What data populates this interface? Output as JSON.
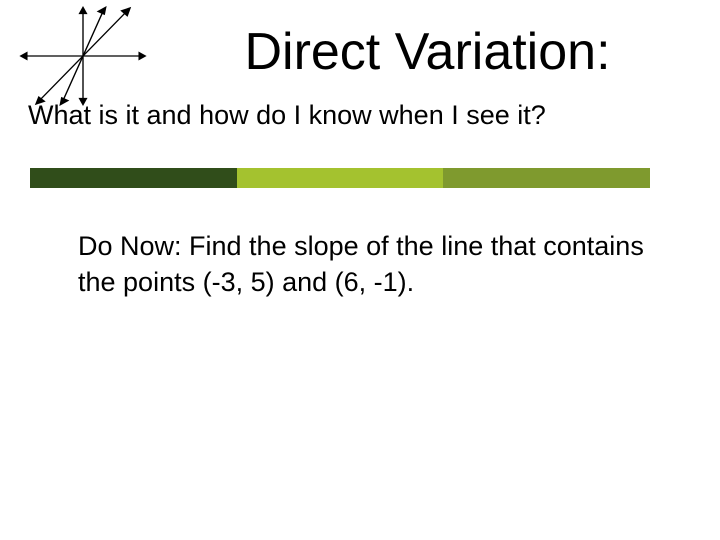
{
  "title": "Direct Variation:",
  "subtitle": "What is it and how do I know when I see it?",
  "body": "Do Now: Find the slope of the line that contains the points (-3, 5) and (6, -1).",
  "colorbar": [
    "#304d1a",
    "#a4c22f",
    "#7f9a2e"
  ],
  "icon": "axes-with-lines"
}
